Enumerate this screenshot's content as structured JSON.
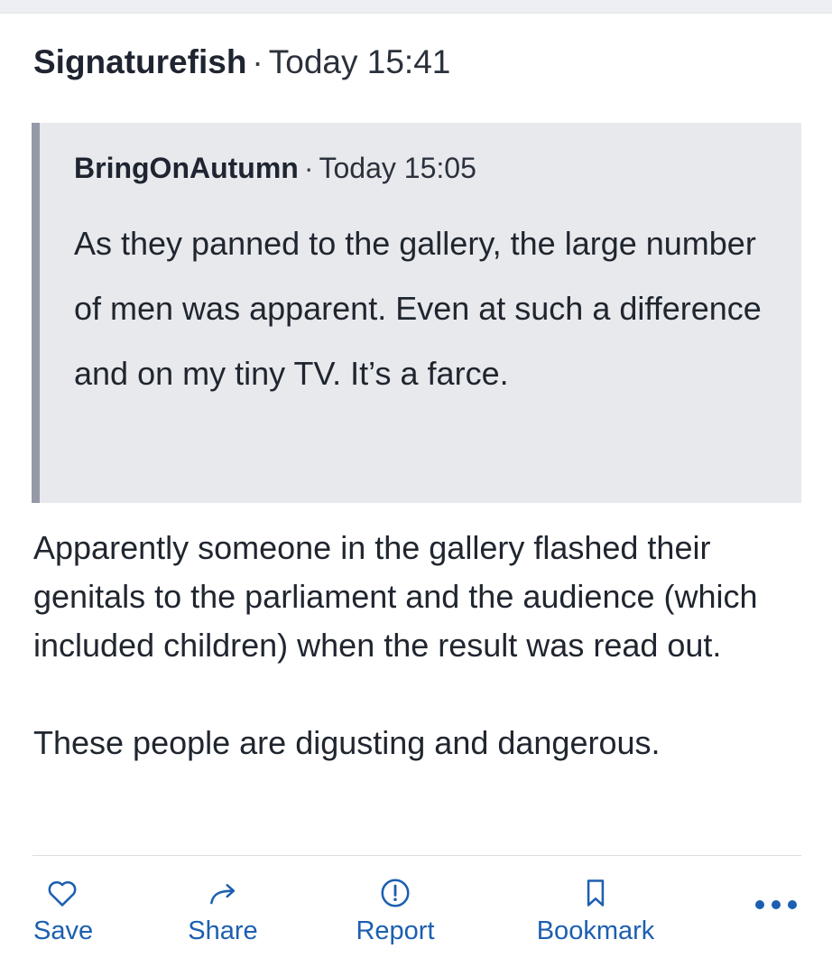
{
  "post": {
    "author": "Signaturefish",
    "separator": "·",
    "timestamp": "Today 15:41",
    "quote": {
      "author": "BringOnAutumn",
      "separator": "·",
      "timestamp": "Today 15:05",
      "text": "As they panned to the gallery, the large number of men was apparent. Even at such a difference and on my tiny TV. It’s a farce."
    },
    "paragraphs": [
      "Apparently someone in the gallery flashed their genitals to the parliament and the audience (which included children) when the result was read out.",
      "These people are digusting and dangerous."
    ]
  },
  "actions": {
    "save": "Save",
    "share": "Share",
    "report": "Report",
    "bookmark": "Bookmark"
  },
  "colors": {
    "accent": "#1c5fb0",
    "quote_bg": "#e8e9ed",
    "quote_bar": "#9599a8",
    "text": "#1f2530"
  },
  "icons": {
    "save": "heart-icon",
    "share": "share-arrow-icon",
    "report": "exclamation-circle-icon",
    "bookmark": "bookmark-icon",
    "more": "more-dots-icon"
  }
}
